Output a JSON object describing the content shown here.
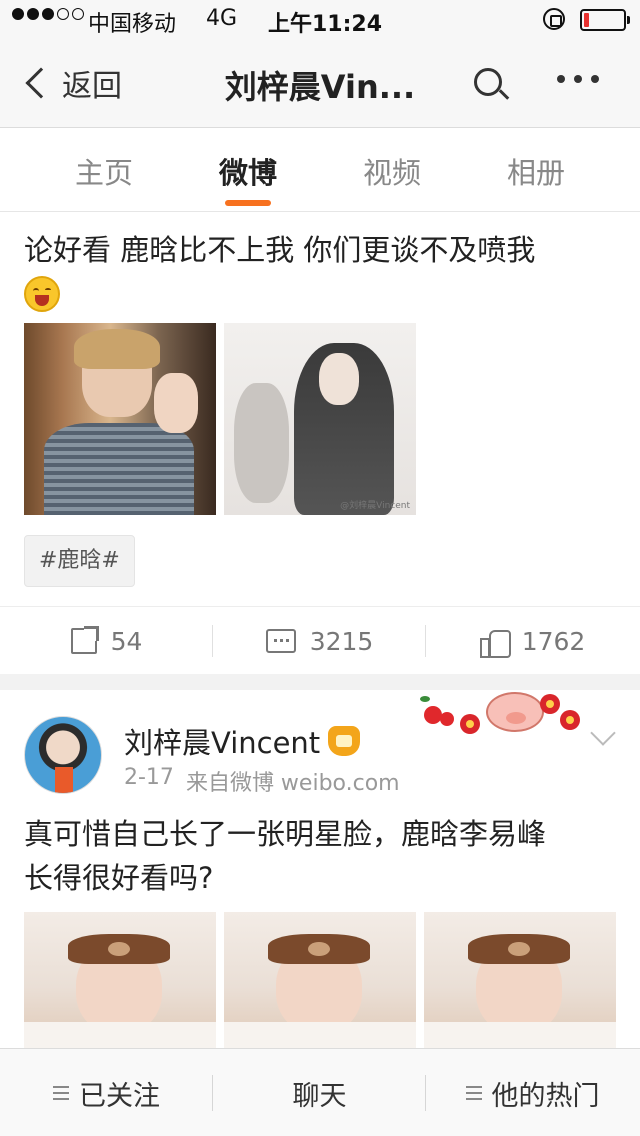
{
  "status_bar": {
    "carrier": "中国移动",
    "network": "4G",
    "time": "上午11:24",
    "signal_bars_filled": 3,
    "signal_bars_total": 5,
    "battery_level": 0.12,
    "battery_color": "#e8312f"
  },
  "nav": {
    "back_label": "返回",
    "title": "刘梓晨Vin...",
    "search_icon": "search-icon",
    "more_icon": "more-icon"
  },
  "tabs": [
    {
      "label": "主页",
      "active": false
    },
    {
      "label": "微博",
      "active": true
    },
    {
      "label": "视频",
      "active": false
    },
    {
      "label": "相册",
      "active": false
    }
  ],
  "accent_color": "#f7711f",
  "post1": {
    "text": "论好看 鹿晗比不上我 你们更谈不及喷我",
    "emoji": "laughing-emoji",
    "images": [
      {
        "name": "luhan-photo"
      },
      {
        "name": "ink-painting",
        "watermark": "@刘梓晨Vincent"
      }
    ],
    "topic": "#鹿晗#",
    "actions": {
      "reposts": "54",
      "comments": "3215",
      "likes": "1762"
    }
  },
  "post2": {
    "author": "刘梓晨Vincent",
    "time": "2-17",
    "source": "来自微博 weibo.com",
    "text_line1": "真可惜自己长了一张明星脸，鹿晗李易峰",
    "text_line2": "长得很好看吗?",
    "images": [
      {
        "name": "bath-photo-1"
      },
      {
        "name": "bath-photo-2"
      },
      {
        "name": "bath-photo-3"
      }
    ]
  },
  "bottom_bar": {
    "follow": "已关注",
    "chat": "聊天",
    "hot": "他的热门"
  }
}
